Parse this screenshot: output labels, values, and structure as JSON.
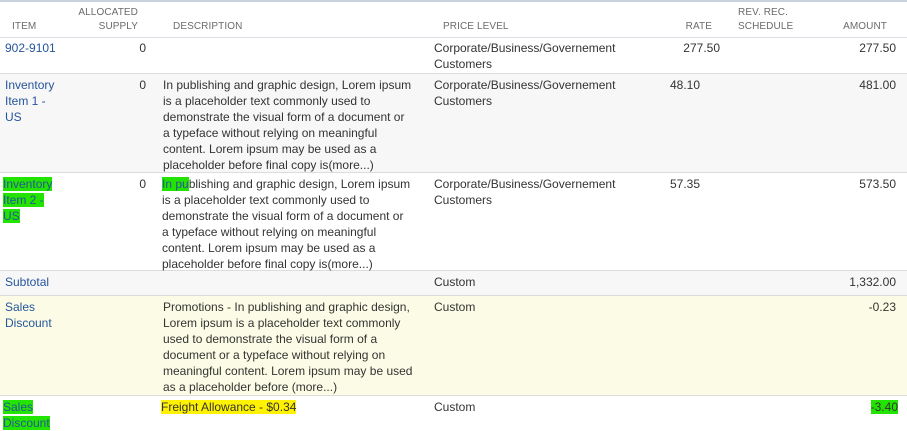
{
  "headers": {
    "item": "ITEM",
    "allocated_supply_1": "ALLOCATED",
    "allocated_supply_2": "SUPPLY",
    "description": "DESCRIPTION",
    "price_level": "PRICE LEVEL",
    "rate": "RATE",
    "rev_rec_1": "REV. REC.",
    "rev_rec_2": "SCHEDULE",
    "amount": "AMOUNT"
  },
  "rows": [
    {
      "item": [
        "902-9101"
      ],
      "allocated": "0",
      "description": [],
      "price_level": [
        "Corporate/Business/Governement",
        "Customers"
      ],
      "rate": "277.50",
      "amount": "277.50"
    },
    {
      "item": [
        "Inventory",
        "Item 1 -",
        "US"
      ],
      "allocated": "0",
      "description": [
        "In publishing and graphic design, Lorem ipsum",
        "is a placeholder text commonly used to",
        "demonstrate the visual form of a document or",
        "a typeface without relying on meaningful",
        "content. Lorem ipsum may be used as a",
        "placeholder before final copy is"
      ],
      "more": "(more...)",
      "price_level": [
        "Corporate/Business/Governement",
        "Customers"
      ],
      "rate": "48.10",
      "amount": "481.00"
    },
    {
      "item": [
        "Inventory",
        "Item 2 -",
        "US"
      ],
      "allocated": "0",
      "description_first_hl": "In pu",
      "description_first_rest": "blishing and graphic design, Lorem ipsum",
      "description": [
        "is a placeholder text commonly used to",
        "demonstrate the visual form of a document or",
        "a typeface without relying on meaningful",
        "content. Lorem ipsum may be used as a",
        "placeholder before final copy is"
      ],
      "more": "(more...)",
      "price_level": [
        "Corporate/Business/Governement",
        "Customers"
      ],
      "rate": "57.35",
      "amount": "573.50"
    },
    {
      "item": [
        "Subtotal"
      ],
      "price_level": [
        "Custom"
      ],
      "amount": "1,332.00"
    },
    {
      "item": [
        "Sales",
        "Discount"
      ],
      "description": [
        "Promotions - In publishing and graphic design,",
        "Lorem ipsum is a placeholder text commonly",
        "used to demonstrate the visual form of a",
        "document or a typeface without relying on",
        "meaningful content. Lorem ipsum may be used",
        "as a placeholder before "
      ],
      "more": "(more...)",
      "price_level": [
        "Custom"
      ],
      "amount": "-0.23"
    },
    {
      "item": [
        "Sales",
        "Discount"
      ],
      "description": [
        "Freight Allowance - $0.34"
      ],
      "price_level": [
        "Custom"
      ],
      "amount": "-3.40"
    }
  ]
}
